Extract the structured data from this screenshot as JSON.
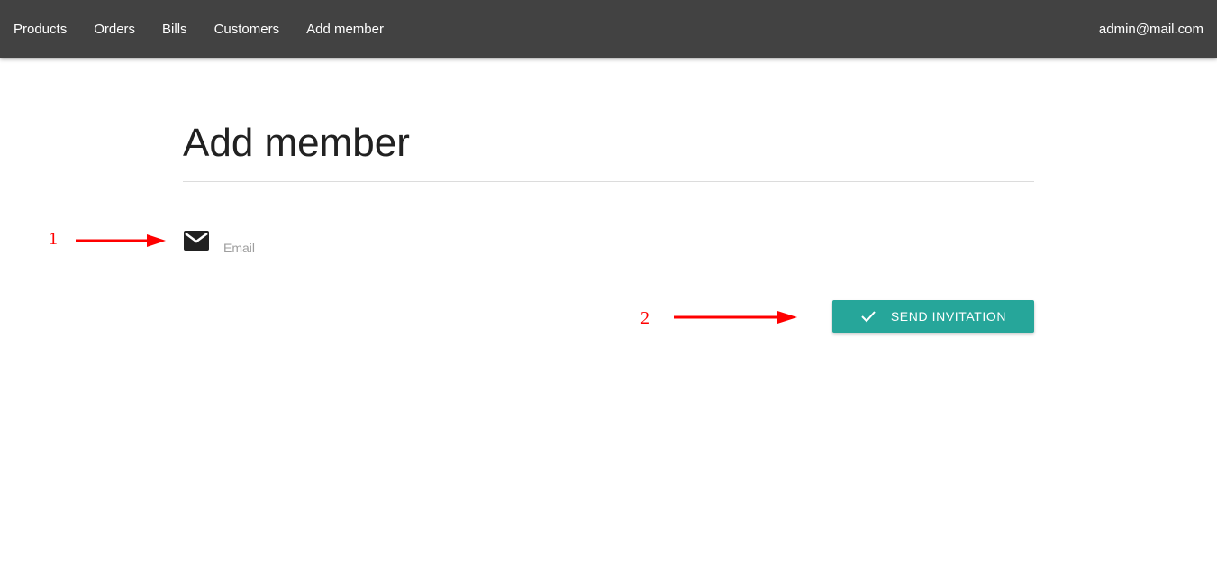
{
  "navbar": {
    "links": [
      {
        "label": "Products"
      },
      {
        "label": "Orders"
      },
      {
        "label": "Bills"
      },
      {
        "label": "Customers"
      },
      {
        "label": "Add member"
      }
    ],
    "user_email": "admin@mail.com"
  },
  "main": {
    "title": "Add member",
    "email_field": {
      "placeholder": "Email",
      "value": ""
    },
    "send_button_label": "SEND INVITATION"
  },
  "annotations": {
    "first_label": "1",
    "second_label": "2"
  },
  "colors": {
    "navbar_bg": "#424242",
    "button_bg": "#26a69a",
    "annotation": "#ff0000"
  }
}
